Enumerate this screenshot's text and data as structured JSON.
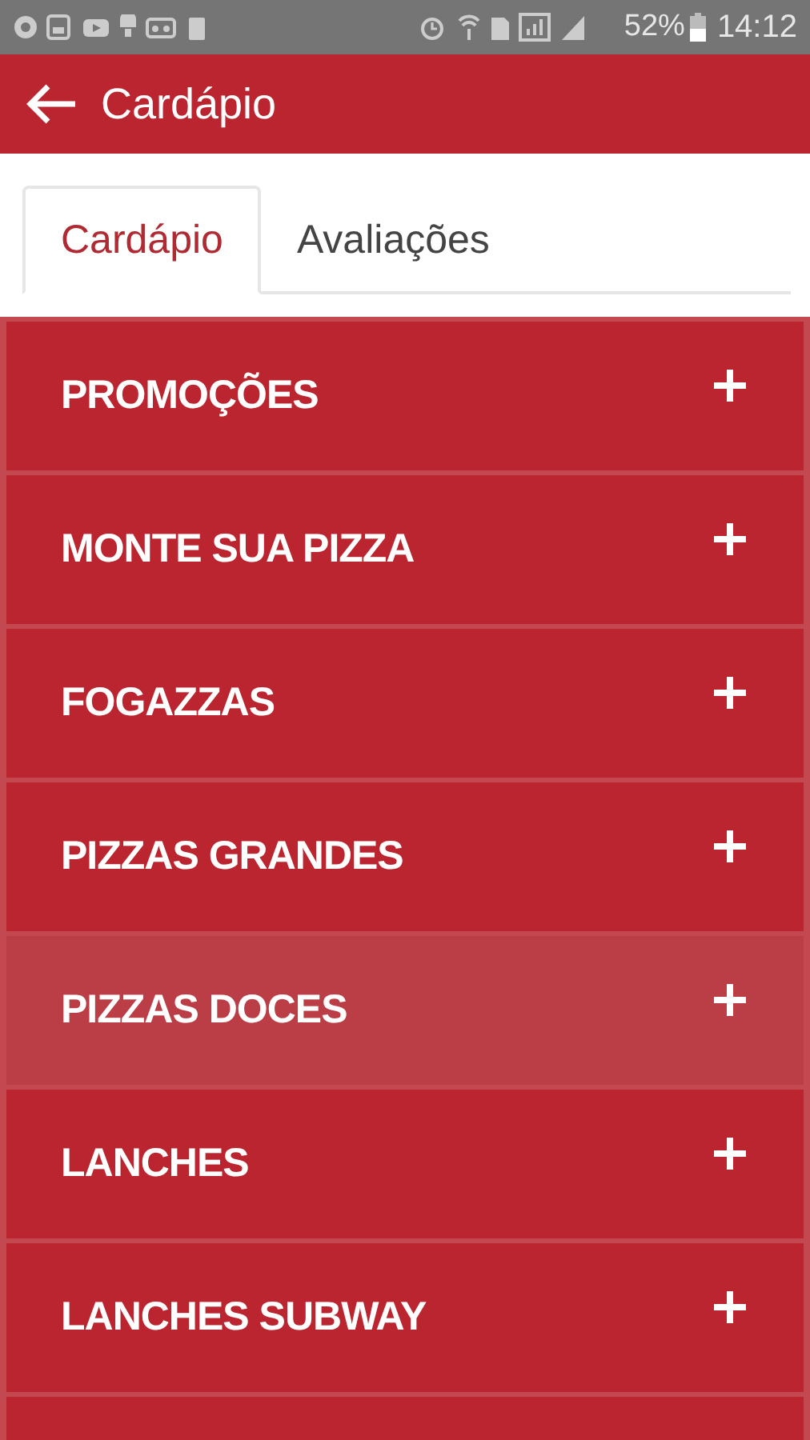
{
  "status_bar": {
    "battery": "52%",
    "time": "14:12"
  },
  "app_bar": {
    "title": "Cardápio"
  },
  "tabs": [
    {
      "label": "Cardápio",
      "selected": true
    },
    {
      "label": "Avaliações",
      "selected": false
    }
  ],
  "categories": [
    {
      "label": "PROMOÇÕES",
      "highlighted": false
    },
    {
      "label": "MONTE SUA PIZZA",
      "highlighted": false
    },
    {
      "label": "FOGAZZAS",
      "highlighted": false
    },
    {
      "label": "PIZZAS GRANDES",
      "highlighted": false
    },
    {
      "label": "PIZZAS DOCES",
      "highlighted": true
    },
    {
      "label": "LANCHES",
      "highlighted": false
    },
    {
      "label": "LANCHES SUBWAY",
      "highlighted": false
    }
  ]
}
